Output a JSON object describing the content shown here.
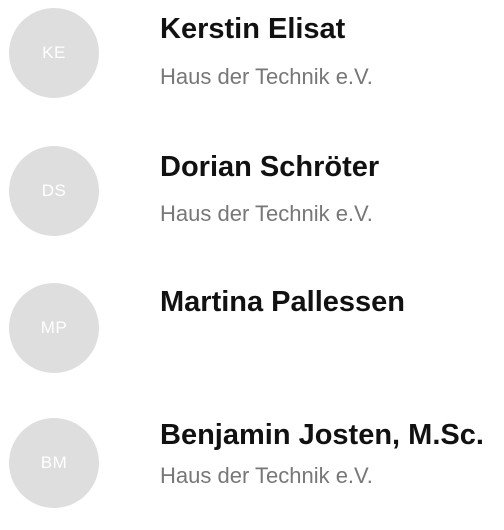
{
  "contacts": [
    {
      "initials": "KE",
      "name": "Kerstin Elisat",
      "organization": "Haus der Technik e.V."
    },
    {
      "initials": "DS",
      "name": "Dorian Schröter",
      "organization": "Haus der Technik e.V."
    },
    {
      "initials": "MP",
      "name": "Martina Pallessen",
      "organization": ""
    },
    {
      "initials": "BM",
      "name": "Benjamin Josten, M.Sc.",
      "organization": "Haus der Technik e.V."
    }
  ],
  "colors": {
    "avatar_background": "#dedede",
    "avatar_text": "#ffffff",
    "name_text": "#111111",
    "organization_text": "#777777"
  }
}
